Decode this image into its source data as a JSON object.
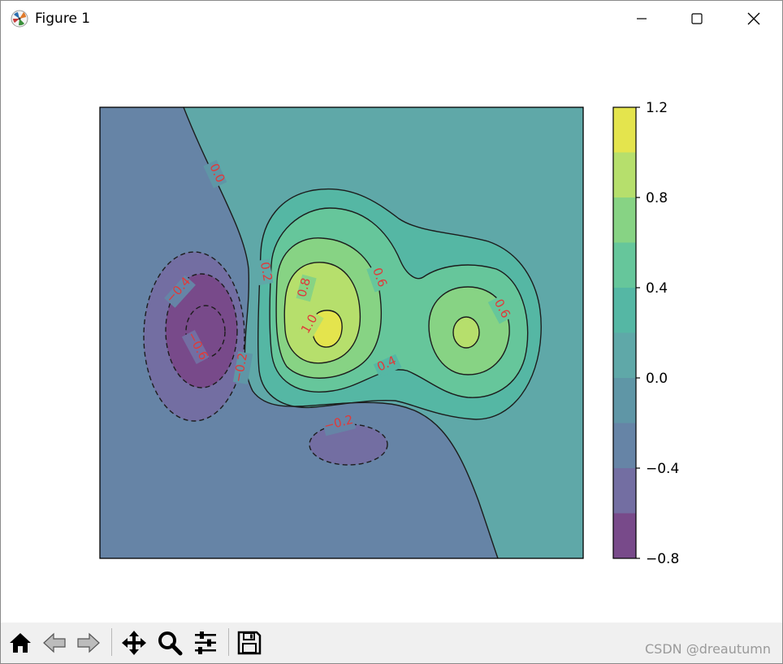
{
  "window": {
    "title": "Figure 1"
  },
  "icons": {
    "app": "matplotlib-icon",
    "minimize": "minimize-icon",
    "maximize": "maximize-icon",
    "close": "close-icon",
    "home": "home-icon",
    "back": "back-arrow-icon",
    "forward": "forward-arrow-icon",
    "pan": "move-arrows-icon",
    "zoom": "magnifier-icon",
    "configure": "sliders-icon",
    "save": "floppy-disk-icon"
  },
  "chart_data": {
    "type": "contour",
    "title": "",
    "xlabel": "",
    "ylabel": "",
    "axes_ticks_visible": false,
    "colormap": "viridis (alpha 0.75)",
    "fill_levels": [
      -0.8,
      -0.6,
      -0.4,
      -0.2,
      0.0,
      0.2,
      0.4,
      0.6,
      0.8,
      1.0,
      1.2
    ],
    "level_colors": [
      "#784a8a",
      "#736ea2",
      "#6684a6",
      "#5f96a6",
      "#5fa8a8",
      "#55b7a4",
      "#66c69b",
      "#87d384",
      "#b6df6c",
      "#e4e44d"
    ],
    "colorbar": {
      "min": -0.8,
      "max": 1.2,
      "tick_values": [
        1.2,
        0.8,
        0.4,
        0.0,
        -0.4,
        -0.8
      ],
      "tick_labels": [
        "1.2",
        "0.8",
        "0.4",
        "0.0",
        "−0.4",
        "−0.8"
      ]
    },
    "contour_labels": [
      "0.0",
      "0.2",
      "0.8",
      "0.6",
      "1.0",
      "0.6",
      "0.4",
      "−0.4",
      "−0.6",
      "−0.2",
      "−0.2"
    ],
    "features": [
      {
        "type": "maximum",
        "approx_value": 1.1
      },
      {
        "type": "local maximum",
        "approx_value": 0.9
      },
      {
        "type": "minimum",
        "approx_value": -0.7
      },
      {
        "type": "local minimum",
        "approx_value": -0.25
      }
    ]
  },
  "watermark": "CSDN @dreautumn"
}
